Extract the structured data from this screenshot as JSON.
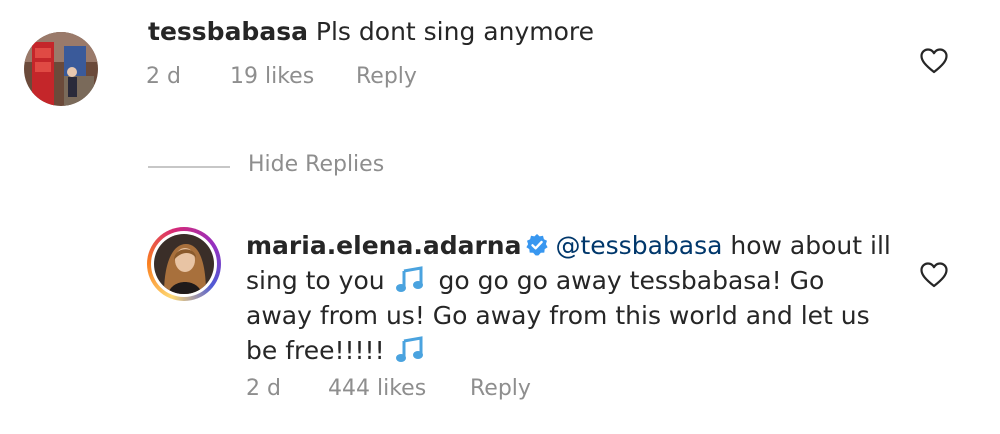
{
  "comment": {
    "username": "tessbabasa",
    "text": "Pls dont sing anymore",
    "time": "2 d",
    "likes": "19 likes",
    "reply_label": "Reply"
  },
  "hide_replies_label": "Hide Replies",
  "reply": {
    "username": "maria.elena.adarna",
    "mention": "@tessbabasa",
    "text_part1": " how about ill sing to you ",
    "text_part2": " go go go away tessbabasa! Go away from us! Go away from this world and let us be free!!!!! ",
    "time": "2 d",
    "likes": "444 likes",
    "reply_label": "Reply"
  },
  "icons": {
    "like": "heart-outline-icon",
    "verified": "verified-badge-icon",
    "music": "musical-notes-emoji"
  },
  "colors": {
    "text": "#262626",
    "secondary": "#8e8e8e",
    "mention": "#00376b",
    "verified": "#3897f0",
    "note": "#4aa3df"
  }
}
